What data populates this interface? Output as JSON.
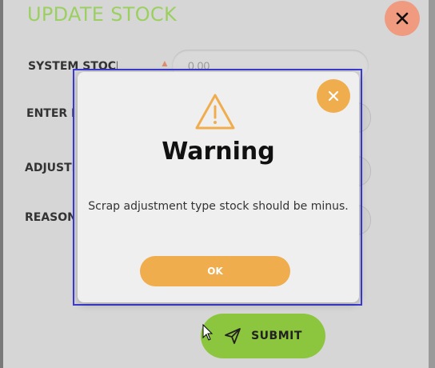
{
  "page": {
    "title": "UPDATE STOCK",
    "accent_color": "#9bd061",
    "close_icon": "close-icon"
  },
  "form": {
    "labels": {
      "system_stock": "SYSTEM STOCK",
      "enter_new": "ENTER N",
      "adjustment": "ADJUSTM",
      "reason": "REASON"
    },
    "system_stock_value": "0.00",
    "submit_label": "SUBMIT",
    "submit_icon": "send-icon",
    "submit_color": "#8cc63e"
  },
  "dialog": {
    "title": "Warning",
    "message": "Scrap adjustment type stock should be minus.",
    "ok_label": "OK",
    "icon": "warning-icon",
    "close_icon": "close-icon",
    "accent_color": "#f0ad4e"
  }
}
